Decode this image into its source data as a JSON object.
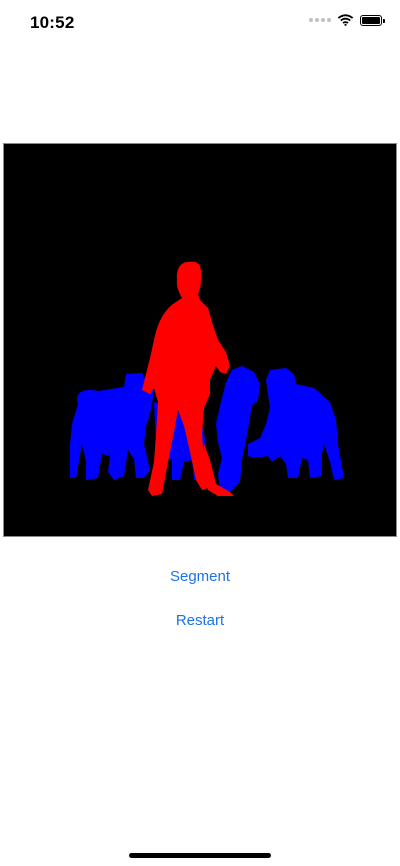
{
  "status_bar": {
    "time": "10:52",
    "icons": [
      "signal-dots-icon",
      "wifi-icon",
      "battery-icon"
    ]
  },
  "segmentation_image": {
    "background_color": "#000000",
    "person_color": "#ff0000",
    "dog_color": "#0000ff"
  },
  "buttons": {
    "segment_label": "Segment",
    "restart_label": "Restart"
  },
  "colors": {
    "accent": "#1a73e8"
  }
}
